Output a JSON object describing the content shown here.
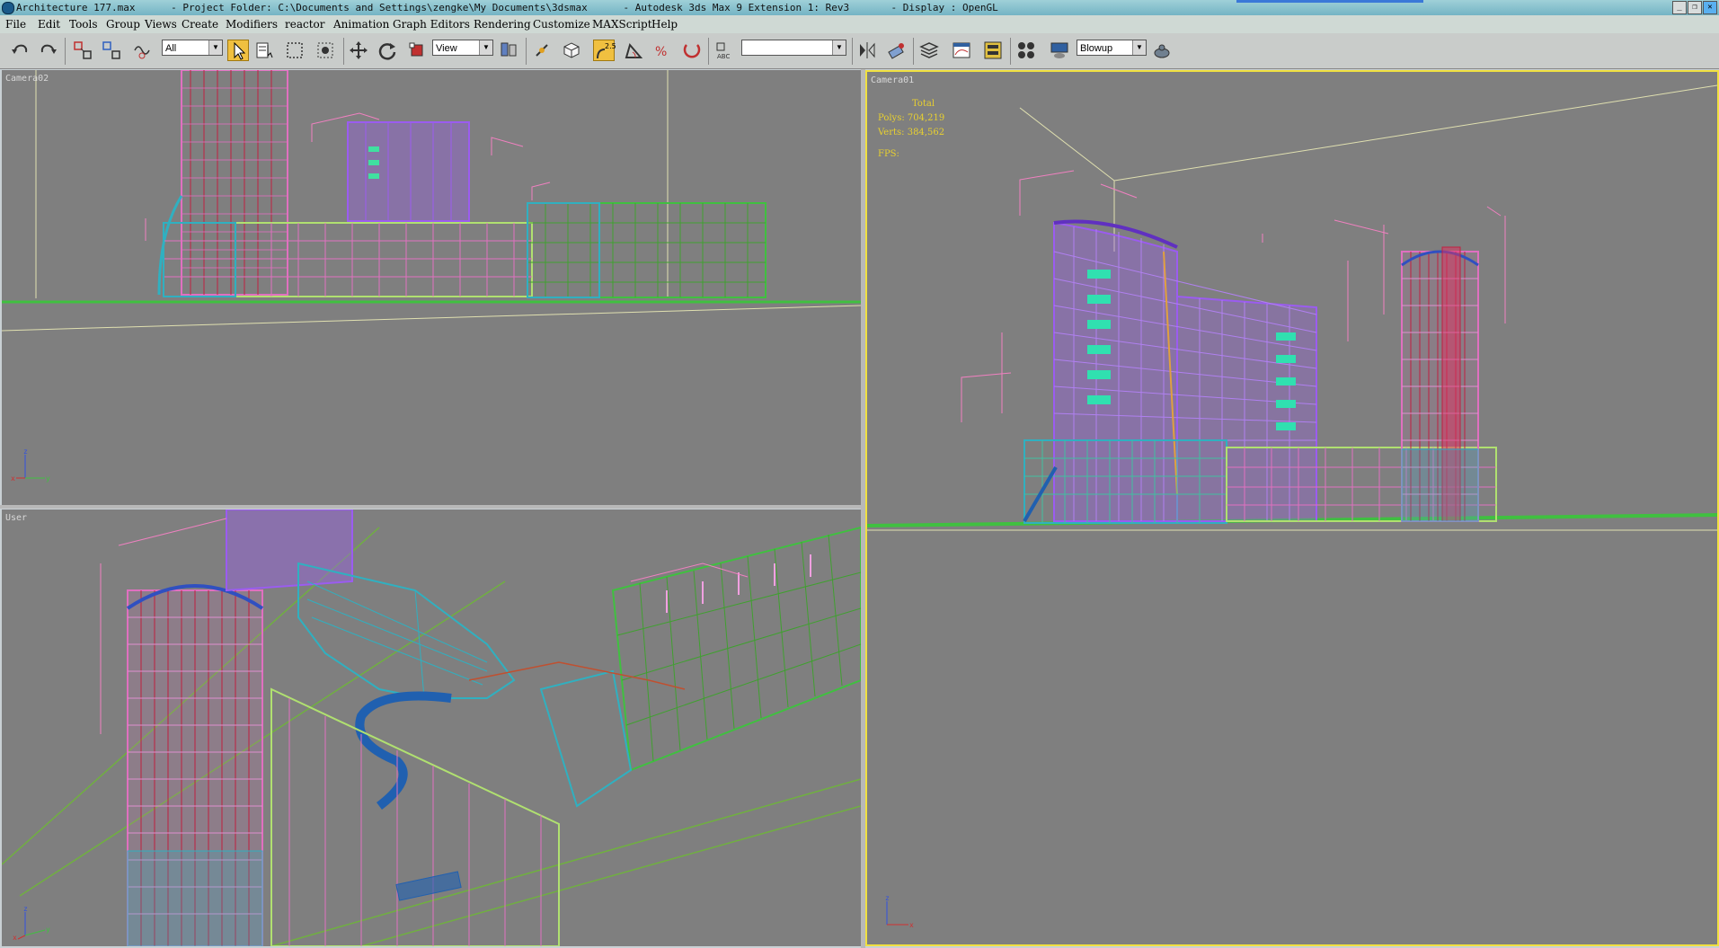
{
  "window": {
    "title": "Architecture 177.max      - Project Folder: C:\\Documents and Settings\\zengke\\My Documents\\3dsmax      - Autodesk 3ds Max 9 Extension 1: Rev3       - Display : OpenGL",
    "controls": [
      "minimize",
      "restore",
      "close"
    ]
  },
  "menu": [
    "File",
    "Edit",
    "Tools",
    "Group",
    "Views",
    "Create",
    "Modifiers",
    "reactor",
    "Animation",
    "Graph Editors",
    "Rendering",
    "Customize",
    "MAXScript",
    "Help"
  ],
  "toolbar": {
    "selection_filter": "All",
    "reference_coord": "View",
    "named_selection": "",
    "render_preset": "Blowup",
    "snap_label": "2.5",
    "icons": [
      "undo-icon",
      "redo-icon",
      "select-link-icon",
      "unlink-icon",
      "bind-spacewarp-icon",
      "select-object-icon",
      "select-by-name-icon",
      "rect-region-icon",
      "window-crossing-icon",
      "move-icon",
      "rotate-icon",
      "scale-icon",
      "pivot-icon",
      "manipulate-icon",
      "keyboard-shortcut-icon",
      "snap-toggle-icon",
      "angle-snap-icon",
      "percent-snap-icon",
      "spinner-snap-icon",
      "edit-named-selection-icon",
      "mirror-icon",
      "align-icon",
      "layer-manager-icon",
      "curve-editor-icon",
      "schematic-view-icon",
      "material-editor-icon",
      "render-scene-icon",
      "quick-render-icon"
    ]
  },
  "viewports": {
    "top_left": {
      "label": "Camera02"
    },
    "bottom_left": {
      "label": "User"
    },
    "right": {
      "label": "Camera01",
      "stats": {
        "heading": "Total",
        "polys": "Polys: 704,219",
        "verts": "Verts: 384,562",
        "fps": "FPS:"
      }
    }
  },
  "axis_labels": {
    "x": "x",
    "y": "y",
    "z": "z"
  },
  "colors": {
    "viewport_bg": "#7f7f7f",
    "active_border": "#f0e040",
    "wire_purple": "#9b5cf0",
    "wire_green": "#40c040",
    "wire_pink": "#e070c0",
    "wire_cyan": "#30b0c0",
    "wire_red": "#c02040"
  }
}
